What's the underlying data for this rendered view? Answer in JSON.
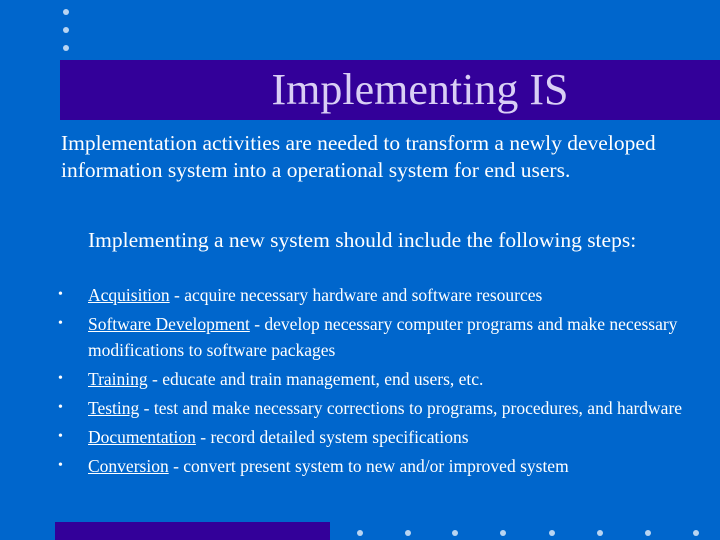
{
  "slide": {
    "title": "Implementing IS",
    "intro": "Implementation activities are needed to transform a newly developed information system into a operational system for end users.",
    "subheading": "Implementing a new system should include the following steps:",
    "bullet_glyph": "•",
    "steps": [
      {
        "term": "Acquisition",
        "desc": " - acquire necessary hardware and software resources"
      },
      {
        "term": "Software Development",
        "desc": " - develop necessary computer programs and make necessary modifications to software packages"
      },
      {
        "term": "Training",
        "desc": " - educate and train management, end users, etc."
      },
      {
        "term": "Testing",
        "desc": " - test and make necessary corrections to programs, procedures, and hardware"
      },
      {
        "term": "Documentation",
        "desc": " - record detailed system specifications"
      },
      {
        "term": "Conversion",
        "desc": " - convert present system to new and/or improved system"
      }
    ]
  },
  "colors": {
    "background": "#0066cc",
    "band": "#330099",
    "title_text": "#d9cff5",
    "dots": "#b8d4f2"
  }
}
